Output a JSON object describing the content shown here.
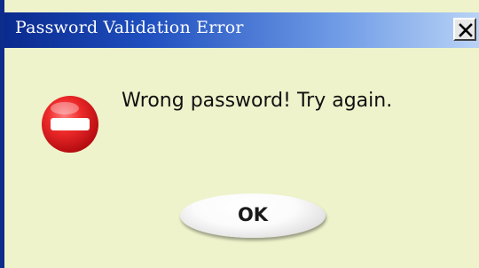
{
  "window": {
    "title": "Password Validation Error",
    "close_icon": "close-x-icon"
  },
  "dialog": {
    "icon": "error-stop-icon",
    "message": "Wrong password! Try again.",
    "ok_label": "OK"
  },
  "colors": {
    "titlebar_start": "#0a2a8e",
    "titlebar_end": "#b9d3f6",
    "background": "#eef3cb",
    "error_red": "#e8232b"
  }
}
